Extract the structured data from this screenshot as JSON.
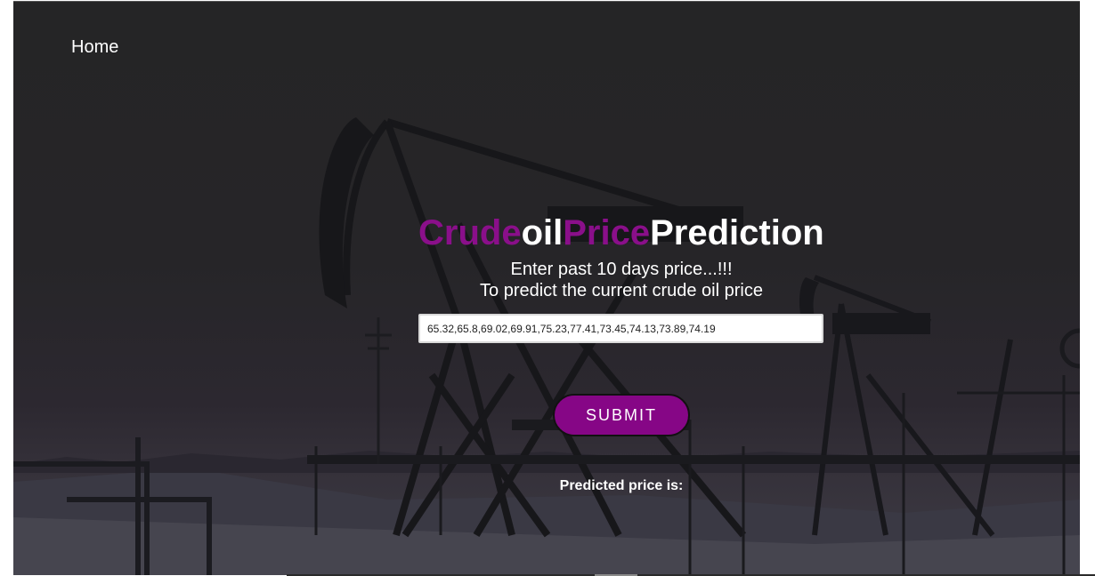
{
  "nav": {
    "home_label": "Home"
  },
  "hero": {
    "title_parts": [
      "Crude",
      "oil",
      "Price",
      "Prediction"
    ],
    "subtitle_line1": "Enter past 10 days price...!!!",
    "subtitle_line2": "To predict the current crude oil price"
  },
  "form": {
    "price_input_value": "65.32,65.8,69.02,69.91,75.23,77.41,73.45,74.13,73.89,74.19",
    "submit_label": "SUBMIT"
  },
  "result": {
    "label": "Predicted price is:"
  },
  "colors": {
    "accent_purple": "#860686",
    "text": "#ffffff",
    "background": "#262528"
  }
}
